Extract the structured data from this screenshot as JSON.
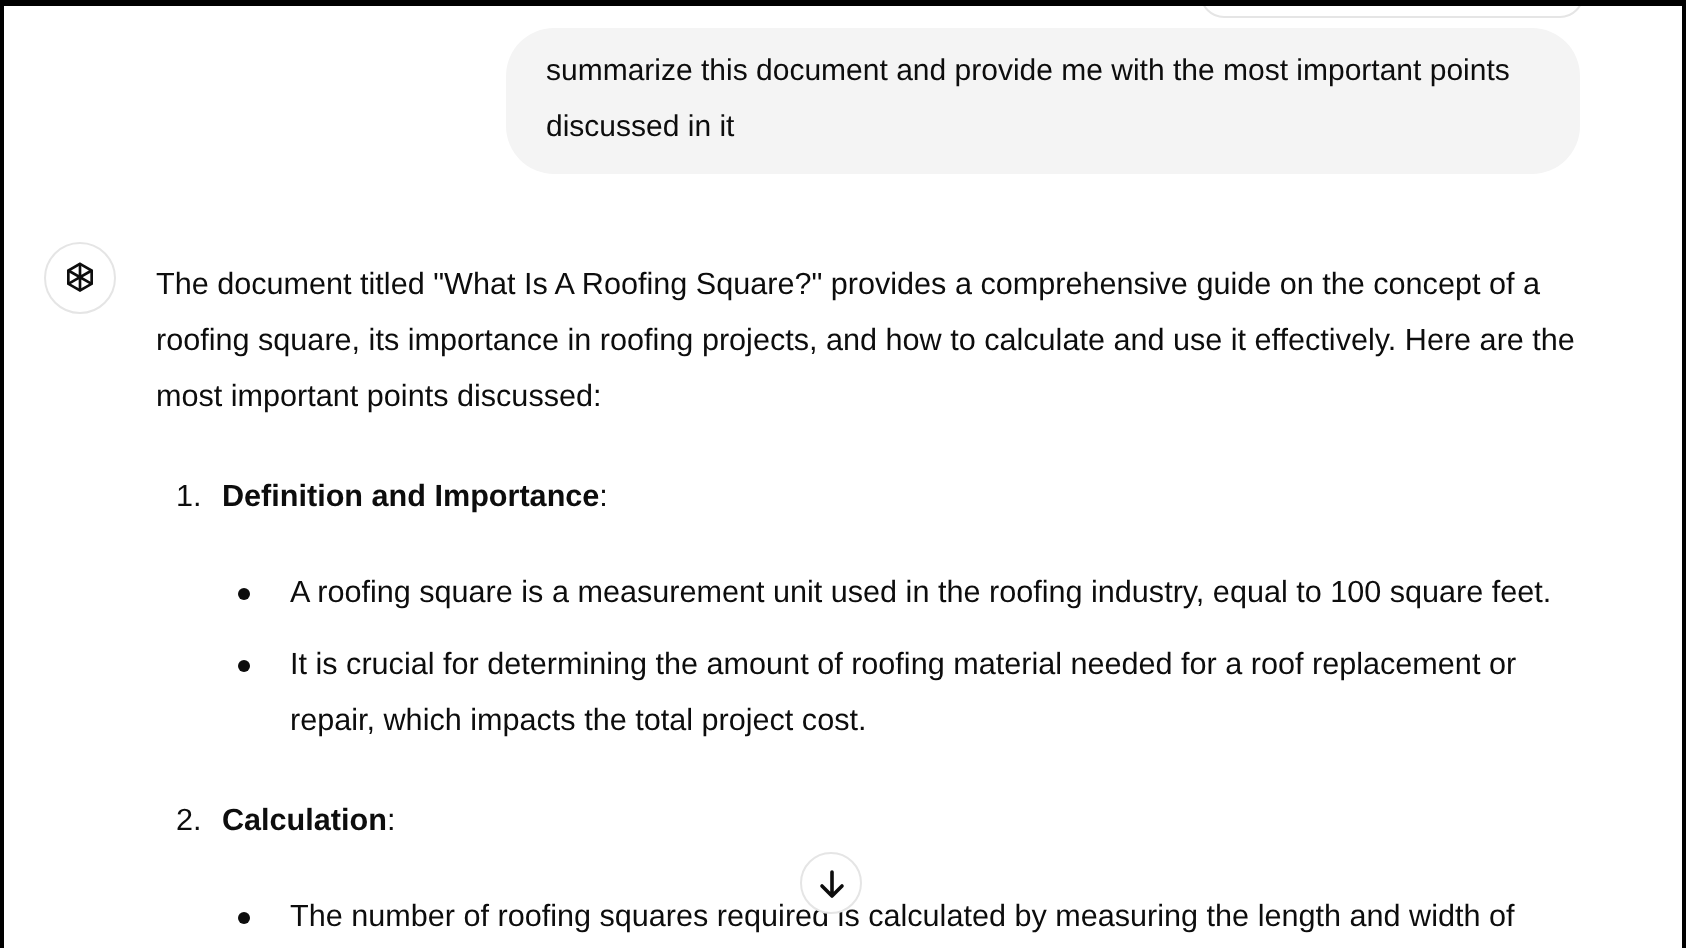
{
  "user_message": "summarize this document and provide me with the most important points discussed in it",
  "assistant": {
    "intro": "The document titled \"What Is A Roofing Square?\" provides a comprehensive guide on the concept of a roofing square, its importance in roofing projects, and how to calculate and use it effectively. Here are the most important points discussed:",
    "sections": [
      {
        "number": "1.",
        "heading": "Definition and Importance",
        "suffix": ":",
        "bullets": [
          "A roofing square is a measurement unit used in the roofing industry, equal to 100 square feet.",
          "It is crucial for determining the amount of roofing material needed for a roof replacement or repair, which impacts the total project cost."
        ]
      },
      {
        "number": "2.",
        "heading": "Calculation",
        "suffix": ":",
        "bullets": [
          "The number of roofing squares required is calculated by measuring the length and width of"
        ]
      }
    ]
  }
}
